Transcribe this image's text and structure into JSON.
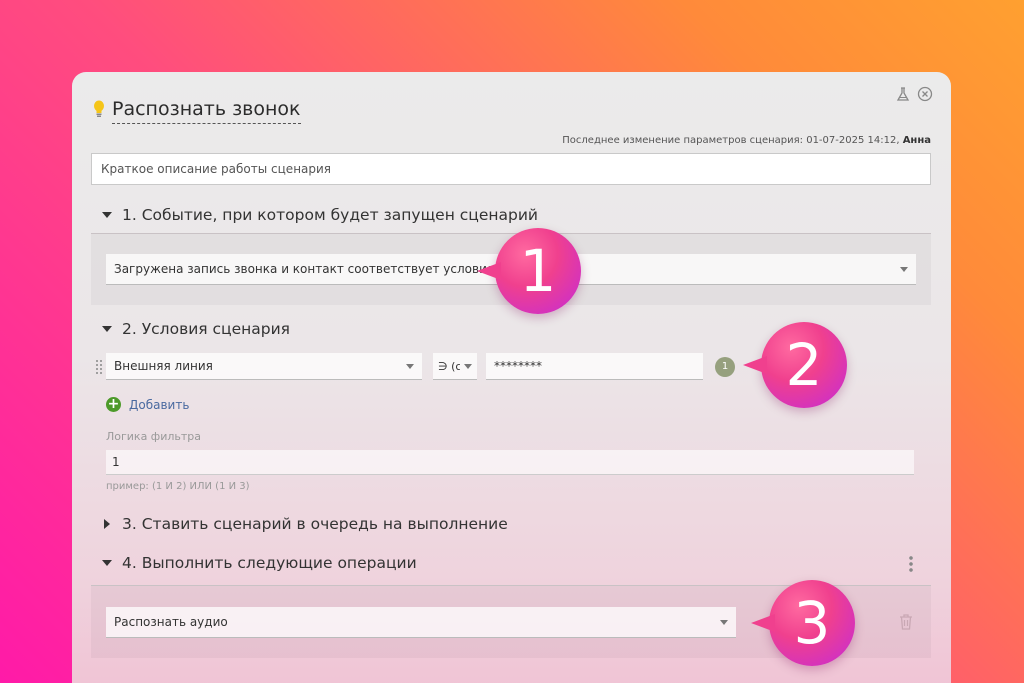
{
  "scenario": {
    "title": "Распознать звонок",
    "last_change_label": "Последнее изменение параметров сценария: 01-07-2025 14:12,",
    "last_change_user": "Анна",
    "description_placeholder": "Краткое описание работы сценария"
  },
  "sections": {
    "s1": {
      "title": "1. Событие, при котором будет запущен сценарий",
      "event_value": "Загружена запись звонка и контакт соответствует условиям"
    },
    "s2": {
      "title": "2. Условия сценария",
      "field_value": "Внешняя линия",
      "operator_value": "∋ (с",
      "input_value": "********",
      "condition_number": "1",
      "add_label": "Добавить",
      "logic_label": "Логика фильтра",
      "logic_value": "1",
      "logic_hint": "пример: (1 И 2) ИЛИ (1 И 3)"
    },
    "s3": {
      "title": "3. Ставить сценарий в очередь на выполнение"
    },
    "s4": {
      "title": "4. Выполнить следующие операции",
      "operation_value": "Распознать аудио"
    }
  },
  "callouts": [
    "1",
    "2",
    "3"
  ],
  "colors": {
    "accent": "#f0408e",
    "badge_gray": "#96a07e",
    "add_green": "#4d9a2a"
  }
}
